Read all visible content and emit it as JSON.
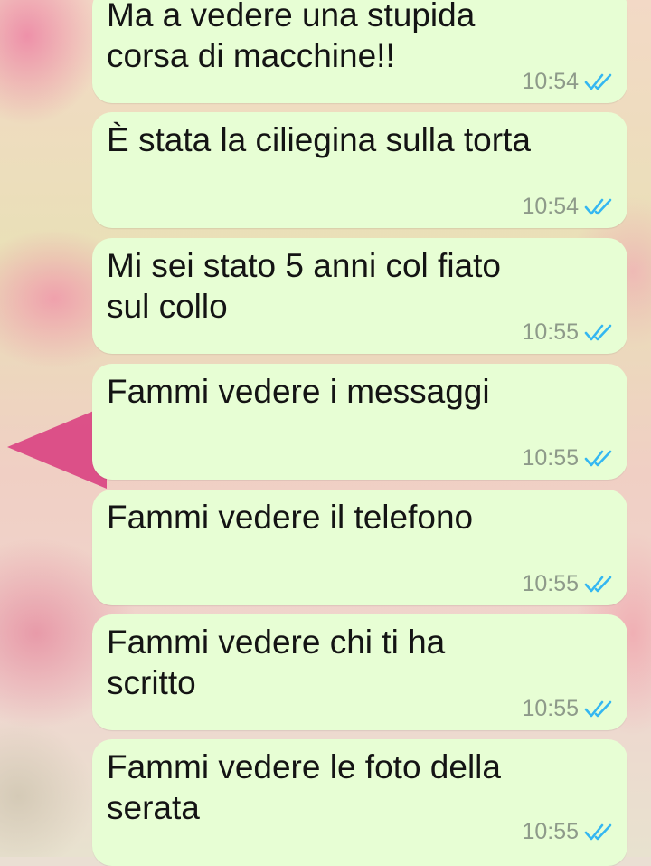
{
  "colors": {
    "bubble_background": "#e7fed4",
    "message_text": "#141414",
    "timestamp": "#8e9a8a",
    "read_ticks": "#34b7f1"
  },
  "messages": [
    {
      "text": "Ma a vedere una stupida\ncorsa di macchine!!",
      "time": "10:54",
      "status_icon": "double-check-read-icon"
    },
    {
      "text": "È stata la ciliegina sulla torta",
      "time": "10:54",
      "status_icon": "double-check-read-icon"
    },
    {
      "text": "Mi sei stato 5 anni col fiato\nsul collo",
      "time": "10:55",
      "status_icon": "double-check-read-icon"
    },
    {
      "text": "Fammi vedere i messaggi",
      "time": "10:55",
      "status_icon": "double-check-read-icon"
    },
    {
      "text": "Fammi vedere il telefono",
      "time": "10:55",
      "status_icon": "double-check-read-icon"
    },
    {
      "text": "Fammi vedere chi ti ha\nscritto",
      "time": "10:55",
      "status_icon": "double-check-read-icon"
    },
    {
      "text": "Fammi vedere le foto della\nserata",
      "time": "10:55",
      "status_icon": "double-check-read-icon"
    }
  ]
}
